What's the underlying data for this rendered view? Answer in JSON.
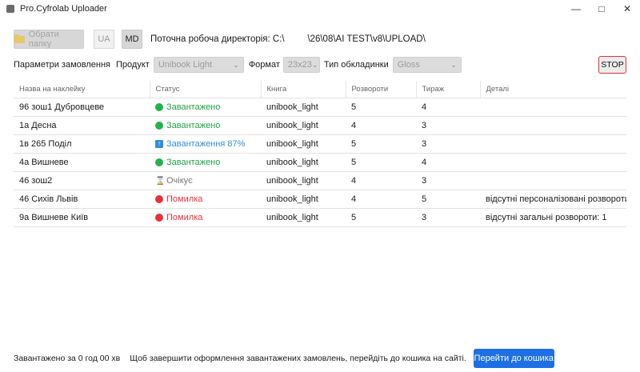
{
  "window": {
    "title": "Pro.Cyfrolab Uploader",
    "controls": [
      "minimize-icon",
      "maximize-icon",
      "close-icon"
    ]
  },
  "toolbar": {
    "choose_folder_label": "Обрати папку",
    "lang_ua": "UA",
    "lang_md": "MD",
    "active_lang": "MD",
    "directory_label": "Поточна робоча директорія: C:\\         \\26\\08\\AI TEST\\v8\\UPLOAD\\"
  },
  "order_params": {
    "label": "Параметри замовлення",
    "product_label": "Продукт",
    "product_value": "Unibook Light",
    "format_label": "Формат",
    "format_value": "23x23",
    "cover_label": "Тип обкладинки",
    "cover_value": "Gloss",
    "stop_label": "STOP"
  },
  "table": {
    "columns": [
      "Назва на наклейку",
      "Статус",
      "Книга",
      "Розвороти",
      "Тираж",
      "Деталі"
    ],
    "rows": [
      {
        "name": "96 зош1 Дубровцеве",
        "status": "Завантажено",
        "status_type": "done",
        "book": "unibook_light",
        "spreads": "5",
        "copies": "4",
        "details": ""
      },
      {
        "name": "1а Десна",
        "status": "Завантажено",
        "status_type": "done",
        "book": "unibook_light",
        "spreads": "4",
        "copies": "3",
        "details": ""
      },
      {
        "name": "1в 265 Поділ",
        "status": "Завантаження 87%",
        "status_type": "uploading",
        "progress_percent": 87,
        "book": "unibook_light",
        "spreads": "5",
        "copies": "3",
        "details": ""
      },
      {
        "name": "4а Вишневе",
        "status": "Завантажено",
        "status_type": "done",
        "book": "unibook_light",
        "spreads": "5",
        "copies": "4",
        "details": ""
      },
      {
        "name": "46 зош2",
        "status": "Очікує",
        "status_type": "waiting",
        "book": "unibook_light",
        "spreads": "4",
        "copies": "3",
        "details": ""
      },
      {
        "name": "46 Сихів Львів",
        "status": "Помилка",
        "status_type": "error",
        "book": "unibook_light",
        "spreads": "4",
        "copies": "5",
        "details": "відсутні персоналізовані розвороти:"
      },
      {
        "name": "9а Вишневе Київ",
        "status": "Помилка",
        "status_type": "error",
        "book": "unibook_light",
        "spreads": "5",
        "copies": "3",
        "details": "відсутні загальні розвороти: 1"
      }
    ]
  },
  "colors": {
    "done": "#22b24c",
    "uploading": "#2f8fdc",
    "waiting": "#b29a6c",
    "error": "#e8303a",
    "accent": "#1e6fe4",
    "stop_border": "#d9343c"
  },
  "footer": {
    "uploaded_time": "Завантажено за 0 год 00 хв",
    "message": "Щоб завершити оформлення завантажених замовлень, перейдіть до кошика на сайті.",
    "cart_button": "Перейти до кошика"
  }
}
